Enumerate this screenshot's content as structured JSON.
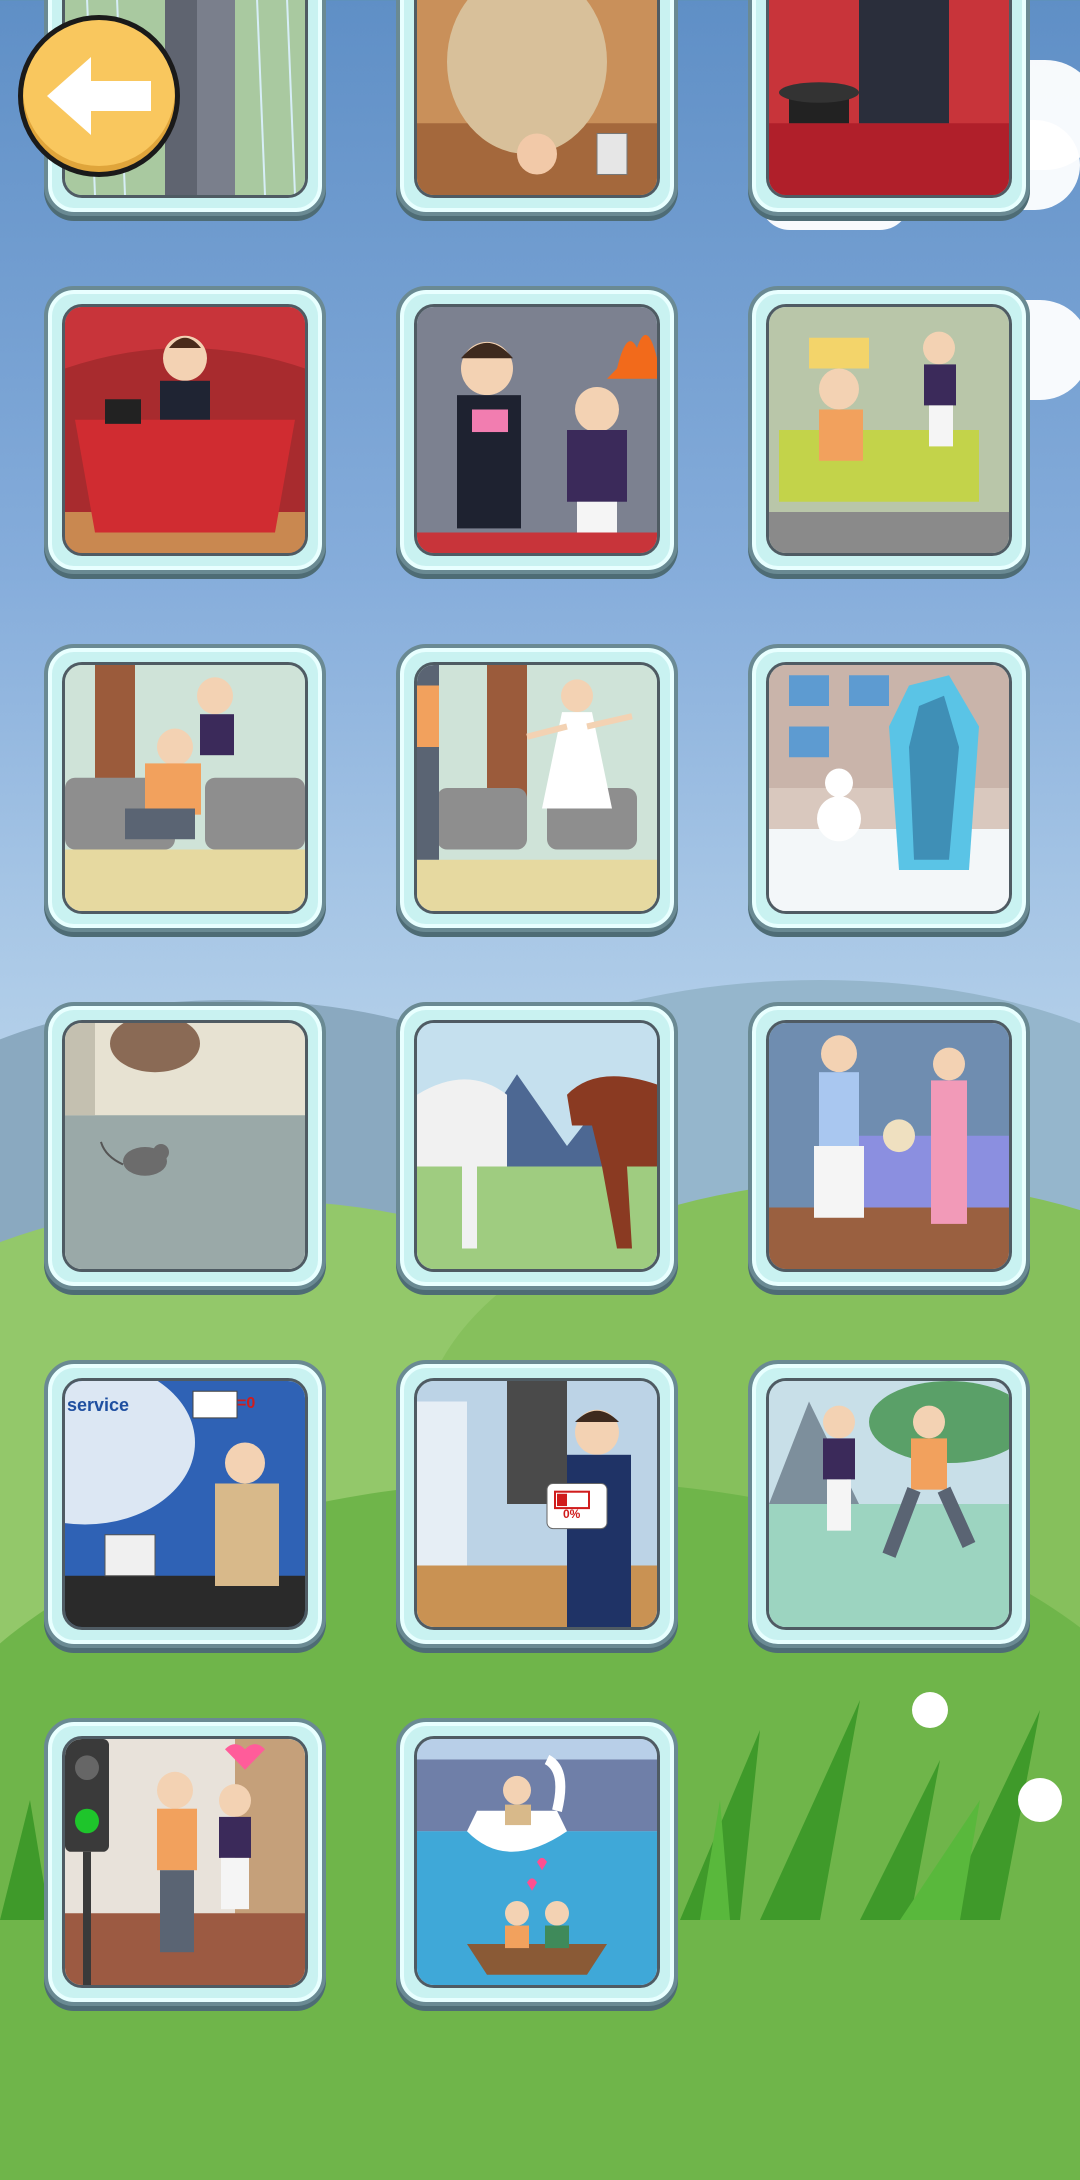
{
  "screen": "level-select",
  "back_button": {
    "icon": "arrow-left-icon"
  },
  "colors": {
    "card_frame": "#c9f2f1",
    "card_border": "#6a8a93",
    "back_button_fill": "#f9c75e"
  },
  "levels": [
    {
      "scene": "rain-man"
    },
    {
      "scene": "tea-table"
    },
    {
      "scene": "magic-stage-hat"
    },
    {
      "scene": "magician-table"
    },
    {
      "scene": "magician-fire"
    },
    {
      "scene": "pillow-sofa"
    },
    {
      "scene": "forest-shoe"
    },
    {
      "scene": "forest-dancer"
    },
    {
      "scene": "frozen-man"
    },
    {
      "scene": "mouse-room"
    },
    {
      "scene": "two-horses"
    },
    {
      "scene": "pajama-couple"
    },
    {
      "scene": "phone-service",
      "text": "service",
      "badge": "=0"
    },
    {
      "scene": "battery-man",
      "badge": "0%"
    },
    {
      "scene": "lake-dance"
    },
    {
      "scene": "traffic-light-couple"
    },
    {
      "scene": "swan-boat"
    }
  ]
}
